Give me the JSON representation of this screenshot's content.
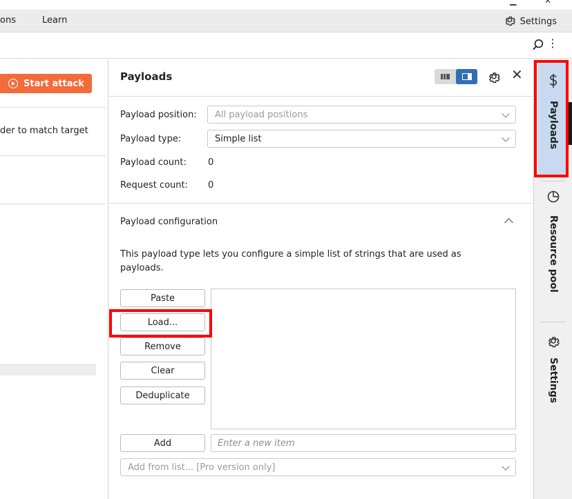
{
  "menubar": {
    "items": [
      "ons",
      "Learn"
    ],
    "settings_label": "Settings"
  },
  "left_pane": {
    "start_attack_label": "Start attack",
    "text": "der to match target"
  },
  "panel": {
    "title": "Payloads",
    "payload_position_label": "Payload position:",
    "payload_position_value": "All payload positions",
    "payload_type_label": "Payload type:",
    "payload_type_value": "Simple list",
    "payload_count_label": "Payload count:",
    "payload_count_value": "0",
    "request_count_label": "Request count:",
    "request_count_value": "0",
    "section_title": "Payload configuration",
    "description": "This payload type lets you configure a simple list of strings that are used as payloads.",
    "buttons": {
      "paste": "Paste",
      "load": "Load...",
      "remove": "Remove",
      "clear": "Clear",
      "deduplicate": "Deduplicate",
      "add": "Add"
    },
    "add_placeholder": "Enter a new item",
    "add_from_list": "Add from list... [Pro version only]"
  },
  "tabs": [
    {
      "label": "Payloads",
      "icon": "dollar-icon",
      "active": true
    },
    {
      "label": "Resource pool",
      "icon": "pie-chart-icon",
      "active": false
    },
    {
      "label": "Settings",
      "icon": "gear-icon",
      "active": false
    }
  ],
  "colors": {
    "accent": "#f26b3a",
    "active_tab": "#c8daf0",
    "toggle_active": "#2f6fb5",
    "highlight": "#ff0000"
  }
}
